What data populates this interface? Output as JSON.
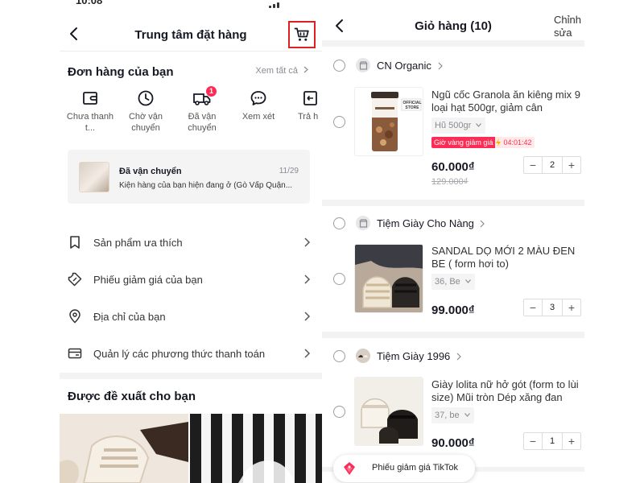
{
  "left": {
    "status_time": "10:08",
    "header": {
      "title": "Trung tâm đặt hàng"
    },
    "orders": {
      "title": "Đơn hàng của bạn",
      "see_all": "Xem tất cả",
      "statuses": [
        {
          "label": "Chưa thanh t...",
          "icon": "wallet-icon"
        },
        {
          "label": "Chờ vận chuyển",
          "icon": "clock-icon"
        },
        {
          "label": "Đã vận chuyển",
          "icon": "truck-icon",
          "badge": "1"
        },
        {
          "label": "Xem xét",
          "icon": "chat-bubble-icon"
        },
        {
          "label": "Trả h",
          "icon": "return-icon"
        }
      ]
    },
    "tracking": {
      "title": "Đã vận chuyển",
      "date": "11/29",
      "description": "Kiện hàng của bạn hiện đang ở (Gò Vấp  Quận..."
    },
    "menu": [
      {
        "label": "Sản phẩm ưa thích",
        "icon": "bookmark-icon"
      },
      {
        "label": "Phiếu giảm giá của bạn",
        "icon": "coupon-icon"
      },
      {
        "label": "Địa chỉ của bạn",
        "icon": "location-pin-icon"
      },
      {
        "label": "Quản lý các phương thức thanh toán",
        "icon": "card-icon"
      }
    ],
    "recommend_title": "Được đề xuất cho bạn"
  },
  "right": {
    "header": {
      "title": "Giỏ hàng (10)",
      "edit": "Chỉnh sửa"
    },
    "shops": [
      {
        "name": "CN Organic",
        "product": {
          "name": "Ngũ cốc Granola ăn kiêng mix 9 loại hạt 500gr, giảm cân",
          "variant": "Hũ 500gr",
          "flash_label": "Giờ vàng giảm giá",
          "flash_timer": "04:01:42",
          "price": "60.000₫",
          "old_price": "129.000₫",
          "qty": "2",
          "image_label": "OFFICIAL STORE"
        }
      },
      {
        "name": "Tiệm Giày Cho Nàng",
        "product": {
          "name": "SANDAL DỌ MỚI 2 MÀU ĐEN BE ( form hơi to)",
          "variant": "36, Be",
          "price": "99.000₫",
          "qty": "3"
        }
      },
      {
        "name": "Tiệm Giày 1996",
        "product": {
          "name": "Giày lolita nữ hở gót (form to lùi size) Mũi tròn Dép xăng đan",
          "variant": "37, be",
          "price": "90.000₫",
          "qty": "1"
        }
      }
    ],
    "voucher": {
      "label": "Phiếu giảm giá TikTok"
    }
  },
  "colors": {
    "accent": "#fe2c55",
    "highlight_box": "#e02020",
    "text": "#161823",
    "muted": "#8a8b91"
  }
}
